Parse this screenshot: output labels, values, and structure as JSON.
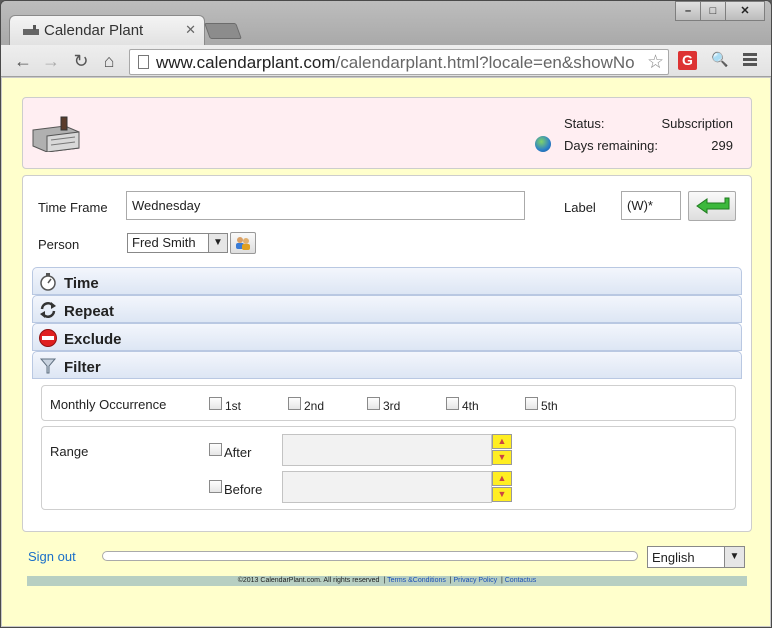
{
  "browser": {
    "tab_title": "Calendar Plant",
    "url_host": "www.calendarplant.com",
    "url_path": "/calendarplant.html?locale=en&showNo",
    "ext_g_label": "G"
  },
  "header": {
    "status_label": "Status:",
    "status_value": "Subscription",
    "days_label": "Days remaining:",
    "days_value": "299"
  },
  "form": {
    "time_frame_label": "Time Frame",
    "time_frame_value": "Wednesday",
    "label_label": "Label",
    "label_value": "(W)*",
    "person_label": "Person",
    "person_value": "Fred Smith"
  },
  "sections": [
    {
      "label": "Time",
      "icon": "stopwatch-icon"
    },
    {
      "label": "Repeat",
      "icon": "repeat-icon"
    },
    {
      "label": "Exclude",
      "icon": "no-entry-icon"
    },
    {
      "label": "Filter",
      "icon": "funnel-icon"
    }
  ],
  "filter": {
    "monthly_label": "Monthly Occurrence",
    "occurrences": [
      "1st",
      "2nd",
      "3rd",
      "4th",
      "5th"
    ],
    "range_label": "Range",
    "after_label": "After",
    "before_label": "Before"
  },
  "footer": {
    "sign_out": "Sign out",
    "language": "English",
    "copyright": "©2013 CalendarPlant.com. All rights reserved",
    "terms": "Terms &Conditions",
    "privacy": "Privacy Policy",
    "contact": "Contactus"
  },
  "colors": {
    "page_bg": "#ffffcc",
    "header_bg": "#ffeef2",
    "link": "#1a6fc9",
    "footer_bar": "#b7cfc2"
  }
}
